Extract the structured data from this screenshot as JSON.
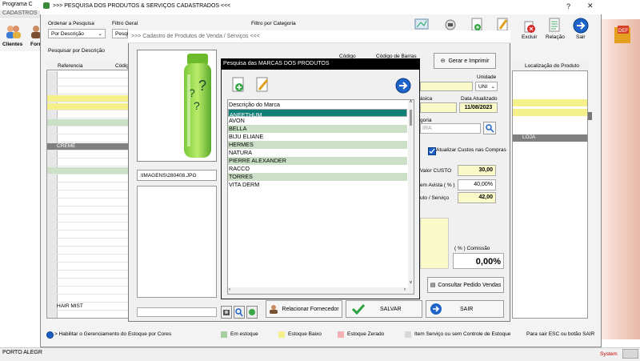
{
  "background_app": {
    "title": "Programa C",
    "menu": "CADASTROS",
    "tools": [
      "Clientes",
      "Forn"
    ],
    "status_left": "PORTO ALEGR",
    "status_right": "System"
  },
  "main_window": {
    "title": ">>> PESQUISA DOS PRODUTOS & SERVIÇOS CADASTRADOS <<<",
    "ordenar_label": "Ordenar a Pesquisa",
    "ordenar_value": "Por Descrição",
    "filtro_geral_label": "Filtro Geral",
    "filtro_geral_value": "Pesqu",
    "filtro_categoria_label": "Filtro por Categoria",
    "pesquisar_label": "Pesquisar por Descrição",
    "toolbar": {
      "excluir": "Excluir",
      "relacao": "Relação",
      "sair": "Sair"
    },
    "grid_headers": [
      "Referencia",
      "Códig"
    ],
    "grid_rows": [
      "",
      "",
      "",
      "",
      "",
      "",
      "",
      "",
      "",
      "CREME",
      "",
      "",
      "",
      "",
      "",
      "",
      "",
      "",
      "",
      "",
      "",
      "",
      "",
      "",
      "",
      "",
      "",
      "",
      "",
      "HAIR MIST"
    ],
    "right_grid_header": "Localização do Produto",
    "right_grid_loja": "LOJA",
    "legend": {
      "habilitar": "> Habilitar o Gerenciamento do Estoque por Cores",
      "em_estoque": "Em estoque",
      "estoque_baixo": "Estoque Baixo",
      "estoque_zerado": "Estoque Zerado",
      "item_servico": "Item Serviço ou sem Controle de Estoque",
      "sair_hint": "Para sair ESC ou botão SAIR"
    },
    "colors": {
      "em_estoque": "#a8cfa0",
      "estoque_baixo": "#f4f08a",
      "estoque_zerado": "#f2b0b0",
      "item_servico": "#d8d8d8"
    }
  },
  "cadastro": {
    "title": ">>> Cadastro de Produtos de Venda / Serviços <<<",
    "codigo_label": "Código",
    "codigo_barras_label": "Código de Barras",
    "gerar_button": "Gerar e Imprimir",
    "unidade_label": "Unidade",
    "unidade_value": "UNI",
    "data_atualizado_label": "Data Atualizado",
    "data_atualizado_value": "11/08/2023",
    "basica_label": "ásica",
    "categoria_label": "goria",
    "categoria_value": "IRA",
    "atualizar_custos": "Atualizar Custos nas Compras",
    "image_path": ".\\IMAGENS\\280408.JPG",
    "valor_custo_label": "Valor CUSTO",
    "valor_custo_value": "30,00",
    "margem_label": "em Avista ( % )",
    "margem_value": "40,00%",
    "preco_label": "uto / Serviço",
    "preco_value": "42,00",
    "comissao_label": "( % ) Comissão",
    "comissao_value": "0,00%",
    "consultar_button": "Consultar Pedido Vendas",
    "relacionar_button": "Relacionar Fornecedor",
    "salvar_button": "SALVAR",
    "sair_button": "SAIR"
  },
  "marcas_modal": {
    "title": "Pesquisa das MARCAS DOS PRODUTOS",
    "column_header": "Descrição do Marca",
    "items": [
      "ANEETHUM",
      "AVON",
      "BELLA",
      "BIJU ELIANE",
      "HERMES",
      "NATURA",
      "PIERRE ALEXANDER",
      "RACCO",
      "TORRES",
      "VITA DERM"
    ],
    "selected_index": 0
  }
}
